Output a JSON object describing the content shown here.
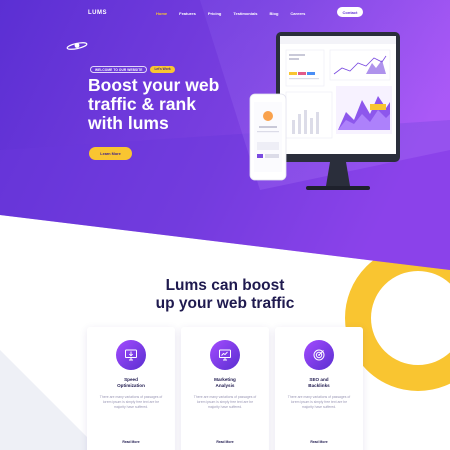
{
  "brand": {
    "logo_text": "LUMS"
  },
  "nav": {
    "items": [
      {
        "label": "Home",
        "active": true
      },
      {
        "label": "Features",
        "active": false
      },
      {
        "label": "Pricing",
        "active": false
      },
      {
        "label": "Testimonials",
        "active": false
      },
      {
        "label": "Blog",
        "active": false
      },
      {
        "label": "Careers",
        "active": false
      }
    ],
    "contact_label": "Contact"
  },
  "hero": {
    "welcome_tag": "WELCOME TO OUR WEBSITE",
    "cta_tag": "Let's Work",
    "headline_1": "Boost your web",
    "headline_2": "traffic & rank",
    "headline_3": "with lums",
    "button_label": "Learn More"
  },
  "section": {
    "title_1": "Lums can boost",
    "title_2": "up your web traffic"
  },
  "cards": [
    {
      "icon": "monitor-download-icon",
      "title_1": "Speed",
      "title_2": "Optimization",
      "text": "There are many variations of passages of lorem ipsum is simply free text are be majority have suffered.",
      "more": "Read More"
    },
    {
      "icon": "analytics-screen-icon",
      "title_1": "Marketing",
      "title_2": "Analysis",
      "text": "There are many variations of passages of lorem ipsum is simply free text are be majority have suffered.",
      "more": "Read More"
    },
    {
      "icon": "target-icon",
      "title_1": "SEO and",
      "title_2": "Backlinks",
      "text": "There are many variations of passages of lorem ipsum is simply free text are be majority have suffered.",
      "more": "Read More"
    }
  ],
  "colors": {
    "purple_dark": "#5b2fd3",
    "purple_light": "#a64cf6",
    "accent_yellow": "#f9c531",
    "heading_navy": "#1f1a4f"
  }
}
